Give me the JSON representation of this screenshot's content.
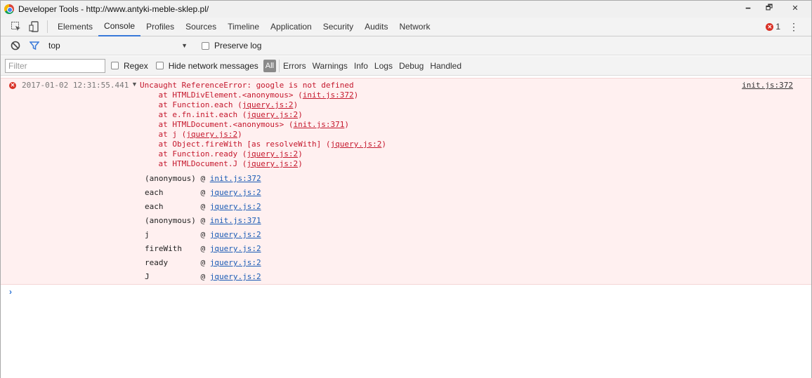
{
  "window": {
    "title": "Developer Tools - http://www.antyki-meble-sklep.pl/",
    "controls": {
      "minimize": "🗕",
      "restore": "🗗",
      "close": "✕"
    }
  },
  "tabs": [
    "Elements",
    "Console",
    "Profiles",
    "Sources",
    "Timeline",
    "Application",
    "Security",
    "Audits",
    "Network"
  ],
  "active_tab": "Console",
  "error_count": "1",
  "context": {
    "value": "top",
    "preserve_log_label": "Preserve log"
  },
  "filterbar": {
    "placeholder": "Filter",
    "regex_label": "Regex",
    "hide_network_label": "Hide network messages",
    "all_label": "All",
    "levels": [
      "Errors",
      "Warnings",
      "Info",
      "Logs",
      "Debug",
      "Handled"
    ]
  },
  "console": {
    "timestamp": "2017-01-02 12:31:55.441",
    "source": "init.js:372",
    "error_lines": [
      {
        "text": "Uncaught ReferenceError: google is not defined",
        "link": ""
      },
      {
        "text": "    at HTMLDivElement.<anonymous> (",
        "link": "init.js:372",
        "after": ")"
      },
      {
        "text": "    at Function.each (",
        "link": "jquery.js:2",
        "after": ")"
      },
      {
        "text": "    at e.fn.init.each (",
        "link": "jquery.js:2",
        "after": ")"
      },
      {
        "text": "    at HTMLDocument.<anonymous> (",
        "link": "init.js:371",
        "after": ")"
      },
      {
        "text": "    at j (",
        "link": "jquery.js:2",
        "after": ")"
      },
      {
        "text": "    at Object.fireWith [as resolveWith] (",
        "link": "jquery.js:2",
        "after": ")"
      },
      {
        "text": "    at Function.ready (",
        "link": "jquery.js:2",
        "after": ")"
      },
      {
        "text": "    at HTMLDocument.J (",
        "link": "jquery.js:2",
        "after": ")"
      }
    ],
    "stack": [
      {
        "fn": "(anonymous)",
        "link": "init.js:372"
      },
      {
        "fn": "each       ",
        "link": "jquery.js:2"
      },
      {
        "fn": "each       ",
        "link": "jquery.js:2"
      },
      {
        "fn": "(anonymous)",
        "link": "init.js:371"
      },
      {
        "fn": "j          ",
        "link": "jquery.js:2"
      },
      {
        "fn": "fireWith   ",
        "link": "jquery.js:2"
      },
      {
        "fn": "ready      ",
        "link": "jquery.js:2"
      },
      {
        "fn": "J          ",
        "link": "jquery.js:2"
      }
    ],
    "prompt": "›"
  }
}
